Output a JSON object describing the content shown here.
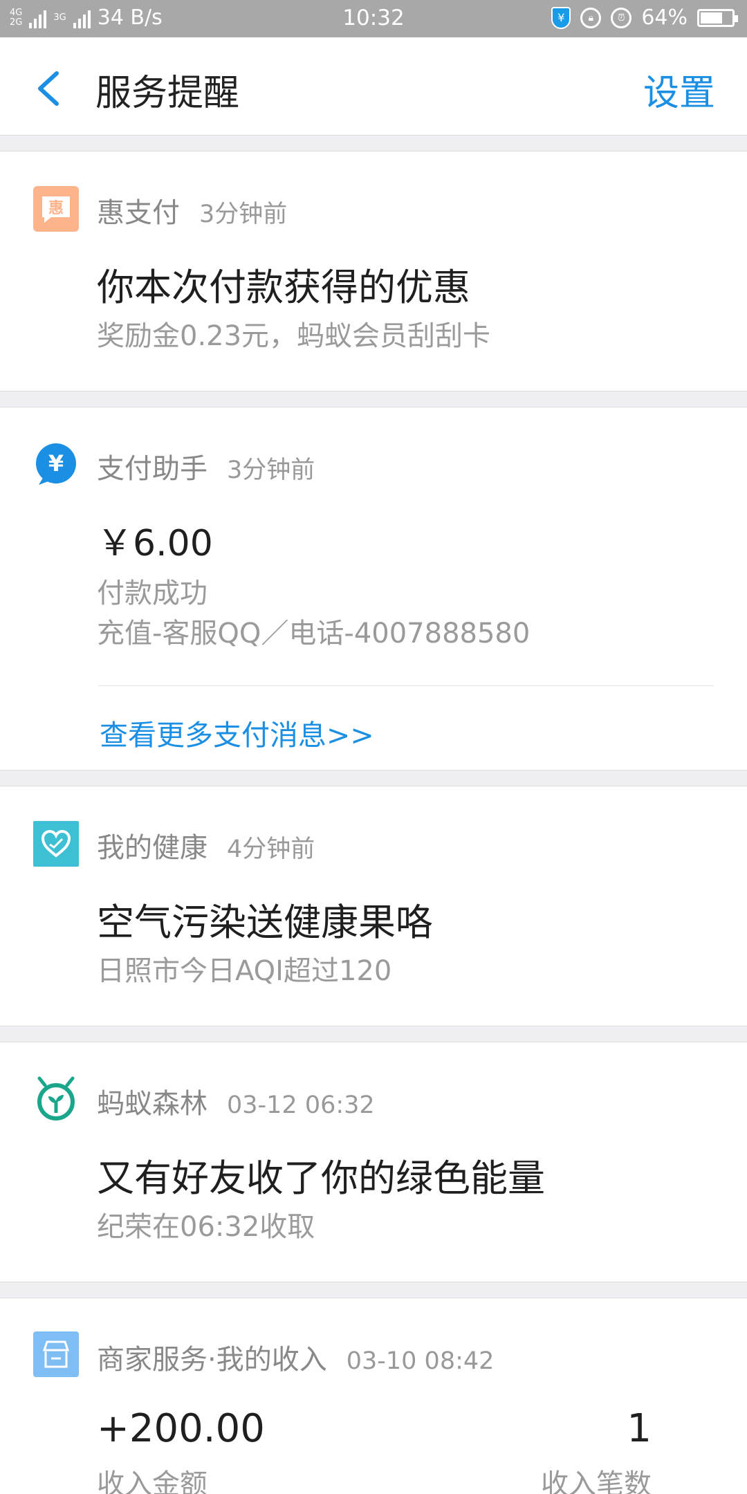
{
  "status_bar": {
    "network_top": "4G",
    "network_bottom": "2G",
    "network_3g": "3G",
    "speed": "34 B/s",
    "time": "10:32",
    "battery": "64%",
    "battery_level": 0.64
  },
  "header": {
    "title": "服务提醒",
    "settings_label": "设置"
  },
  "cards": [
    {
      "app": "惠支付",
      "time": "3分钟前",
      "icon": "hui-pay-icon",
      "icon_glyph": "惠",
      "icon_color": "#fdb48a",
      "title": "你本次付款获得的优惠",
      "sub": "奖励金0.23元，蚂蚁会员刮刮卡"
    },
    {
      "app": "支付助手",
      "time": "3分钟前",
      "icon": "yuan-icon",
      "icon_glyph": "¥",
      "icon_color": "#1a8fe3",
      "amount": "￥6.00",
      "sub1": "付款成功",
      "sub2": "充值-客服QQ／电话-4007888580",
      "more": "查看更多支付消息>>"
    },
    {
      "app": "我的健康",
      "time": "4分钟前",
      "icon": "heart-icon",
      "icon_color": "#3ec0d4",
      "title": "空气污染送健康果咯",
      "sub": "日照市今日AQI超过120"
    },
    {
      "app": "蚂蚁森林",
      "time": "03-12 06:32",
      "icon": "ant-forest-icon",
      "icon_color": "#1aa68b",
      "title": "又有好友收了你的绿色能量",
      "sub": "纪荣在06:32收取"
    },
    {
      "app": "商家服务·我的收入",
      "time": "03-10 08:42",
      "icon": "shop-icon",
      "icon_color": "#7fbdf5",
      "income_amount": "+200.00",
      "income_amount_label": "收入金额",
      "income_count": "1",
      "income_count_label": "收入笔数"
    }
  ]
}
